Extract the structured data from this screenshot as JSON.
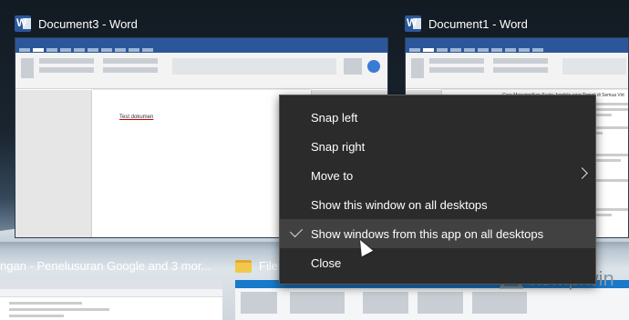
{
  "windows": {
    "document3": {
      "title": "Document3 - Word",
      "body_text": "Test dokumen"
    },
    "document1": {
      "title": "Document1 - Word",
      "body_text": "Cara Menampilkan Suatu Jendela agar Tampil di Semua Virt"
    },
    "chrome": {
      "title": "ngan - Penelusuran Google and 3 mor..."
    },
    "explorer": {
      "title": "File"
    }
  },
  "context_menu": {
    "items": [
      {
        "label": "Snap left"
      },
      {
        "label": "Snap right"
      },
      {
        "label": "Move to"
      },
      {
        "label": "Show this window on all desktops"
      },
      {
        "label": "Show windows from this app on all desktops"
      },
      {
        "label": "Close"
      }
    ]
  },
  "watermark": {
    "text": "kompiwin"
  },
  "colors": {
    "word_blue": "#2b579a",
    "menu_bg": "#2b2b2b",
    "menu_highlight": "#414141"
  }
}
